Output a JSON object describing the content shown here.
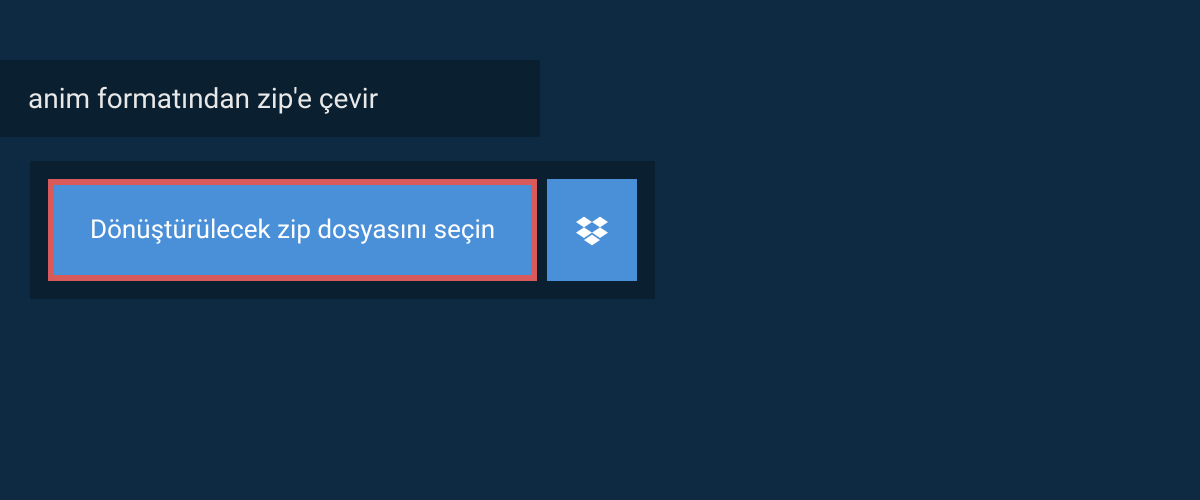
{
  "header": {
    "title": "anim formatından zip'e çevir"
  },
  "upload": {
    "select_file_label": "Dönüştürülecek zip dosyasını seçin",
    "dropbox_icon": "dropbox"
  },
  "colors": {
    "background": "#0e2a42",
    "panel": "#0a1f30",
    "button": "#4a90d9",
    "button_border": "#d85a5a",
    "text_light": "#ffffff"
  }
}
